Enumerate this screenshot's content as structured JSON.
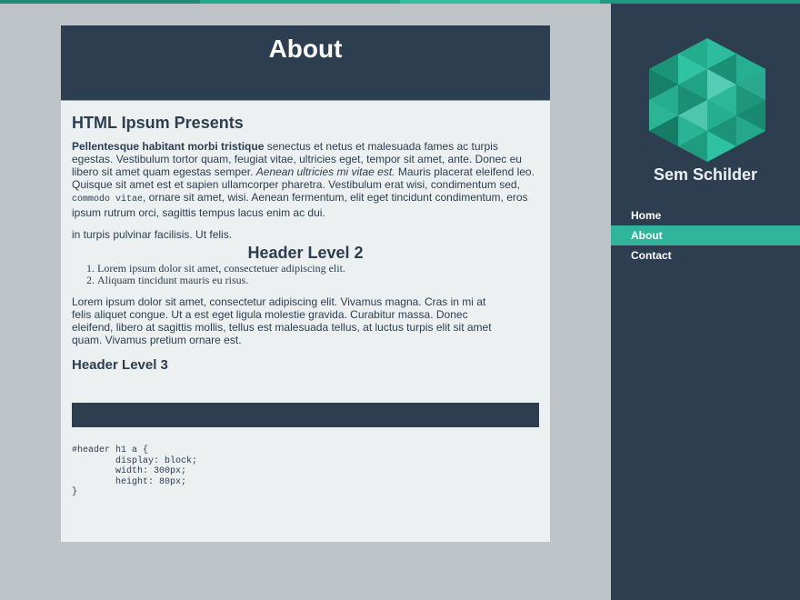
{
  "page": {
    "title": "About",
    "main_heading": "HTML Ipsum Presents"
  },
  "sidebar": {
    "site_name": "Sem Schilder",
    "nav": [
      {
        "label": "Home",
        "active": false
      },
      {
        "label": "About",
        "active": true
      },
      {
        "label": "Contact",
        "active": false
      }
    ]
  },
  "content": {
    "p1": {
      "bold": "Pellentesque habitant morbi tristique",
      "t1": " senectus et netus et malesuada fames ac turpis egestas. Vestibulum tortor quam, feugiat vitae, ultricies eget, tempor sit amet, ante. Donec eu libero sit amet quam egestas semper. ",
      "em": "Aenean ultricies mi vitae est.",
      "t2": " Mauris placerat eleifend leo. Quisque sit amet est et sapien ullamcorper pharetra. Vestibulum erat wisi, condimentum sed, ",
      "code": "commodo vitae",
      "t3": ", ornare sit amet, wisi. Aenean fermentum, elit eget tincidunt condimentum, eros ipsum rutrum orci, sagittis tempus lacus enim ac dui."
    },
    "p2": "in turpis pulvinar facilisis. Ut felis.",
    "h2": "Header Level 2",
    "list": [
      "Lorem ipsum dolor sit amet, consectetuer adipiscing elit.",
      "Aliquam tincidunt mauris eu risus."
    ],
    "blockquote": "Lorem ipsum dolor sit amet, consectetur adipiscing elit. Vivamus magna. Cras in mi at felis aliquet congue. Ut a est eget ligula molestie gravida. Curabitur massa. Donec eleifend, libero at sagittis mollis, tellus est malesuada tellus, at luctus turpis elit sit amet quam. Vivamus pretium ornare est.",
    "h3": "Header Level 3",
    "code_block": "#header h1 a {\n        display: block;\n        width: 300px;\n        height: 80px;\n}"
  },
  "colors": {
    "background": "#bdc3c7",
    "dark": "#2c3e50",
    "accent": "#2fb59b",
    "panel": "#ecf0f1"
  }
}
